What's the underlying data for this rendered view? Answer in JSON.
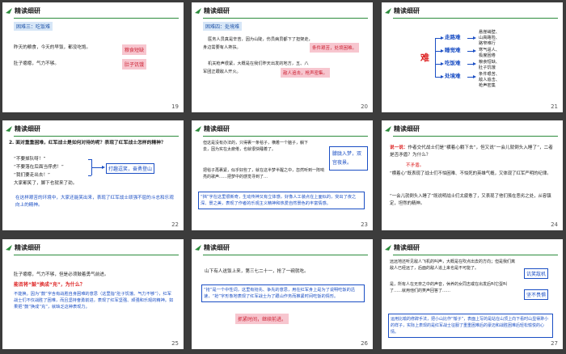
{
  "header_title": "精读细研",
  "slides": {
    "s19": {
      "page": "19",
      "caption": "困难三：吃饭难",
      "line1": "昨天的粮食，今天的早饭，都没吃饱。",
      "line2": "肚子瘪瘪，气力不够。",
      "box1": "粮食短缺",
      "box2": "肚子饥饿"
    },
    "s20": {
      "page": "20",
      "caption": "困难四：处境难",
      "line1": "医务人员真是辛苦，因为山陡，伤员病员都下了担架走，",
      "line2": "身边需要有人搀扶。",
      "box1": "条件艰苦，处境困难。",
      "line3": "机关枪声很紧，大概是在我们昨天出发的地方，五、八",
      "line4": "军团正跟敌人开火。",
      "box2": "敌人追击，枪声密集。"
    },
    "s21": {
      "page": "21",
      "center_char": "难",
      "items": [
        "走路难",
        "睡觉难",
        "吃饭难",
        "处境难"
      ],
      "details": [
        "悬崖峭壁、",
        "山高路险、",
        "路窄难行",
        "寒气逼人、",
        "极度困倦",
        "粮食短缺、",
        "肚子饥饿",
        "条件艰苦、",
        "敌人追击、",
        "枪声密集"
      ]
    },
    "s22": {
      "page": "22",
      "question": "2. 面对重重困难，红军战士是如何对待的呢？表现了红军战士怎样的精神？",
      "quotes": [
        "“不要掉队呀！”",
        "“不要落在后面当俘虏！”",
        "“我们要走出去！”",
        "大家都笑了，脚下也就来了劲。"
      ],
      "box1": "打趣逗笑，奋勇登山",
      "conclusion": "在这样艰苦的环境中，大家还能笑出来，表现了红军战士顽强不屈的斗志和乐观向上的精神。"
    },
    "s23": {
      "page": "23",
      "para": [
        "但这是没有办法的，只得裹一条毯子，横着一个脑子，躺下去，因为实在太疲倦，也就很快睡着了。",
        "把毯子再裹紧，似乎好些了，就在这半梦半醒之中，忽然听到一阵响亮的歌声……把梦中的感觉寻到了…"
      ],
      "box1": "朦胧入梦，双宫夜景。",
      "note": "“挡”字在这里很新奇，生动传神又有立体感，好像人工装点在上面似的，突出了夜之深、景之美，表现了作者的乐观主义精神和热爱自然景色的丰富情感。"
    },
    "s24": {
      "page": "24",
      "q_label": "说一说：",
      "q_text": "作者交代战士们是“横着心躺下去”，但又说“一会儿就倒头入睡了”，二者是否矛盾？为什么？",
      "ans_label": "不矛盾。",
      "ans_text": "“横着心”既表现了战士们不怕困难、不怕死的英雄气概，又体现了红军严明的纪律。",
      "ans2": "“一会儿就倒头入睡了”既说明战士们太疲惫了，又表现了他们虽在恶劣之处，从容镇定，坦然的精神。"
    },
    "s25": {
      "page": "25",
      "line1": "肚子瘪瘪，气力不够，但是必须鼓着勇气前进。",
      "question": "能否将“鼓”换成“充”，为什么？",
      "answer": "不能换。因为“鼓”字含有战胜自身困难的意思（这里指“肚子饥饿、气力不够”），红军战士们不仅战胜了困难，而且坚持奋勇前进，表现了红军坚强、顽强和乐观的精神。如果把“鼓”换成“充”，就缺乏这种表现力。"
    },
    "s26": {
      "page": "26",
      "line1": "山下有人送饭上来，第三七二十一，抢了一碗就吃。",
      "note": "“抢”是一个中性词，这里有抢先、争先的意思，用在红军身上是为了说明吃饭的迅速，“抢”字形象地表现了红军战士为了跟山作务而推紧时间吃饭的情形。",
      "box1": "抓紧时间，继续前进。"
    },
    "s27": {
      "page": "27",
      "para": "远远地还听见敌人飞机的叫声，大概是在吹点出去的方向；但是我们离敌人已经远了，后面的敌人追上来也是不可能了。",
      "box1": "讥笑敌机",
      "para2": "是，所有人在无奈之中的声音，休养的女同志或在出发后叫它蛋叫了……就用他们的笑声回答了……",
      "box2": "坚不畏惧",
      "note": "运用比喻的修辞手法，把小山比作“矮子”，表面上写的是站在山顶上向下看时山显得渺小的样子，实际上表现的是红军战士征服了重重困难后的豪迈和战胜困难后轻松愉悦的心情。"
    }
  }
}
